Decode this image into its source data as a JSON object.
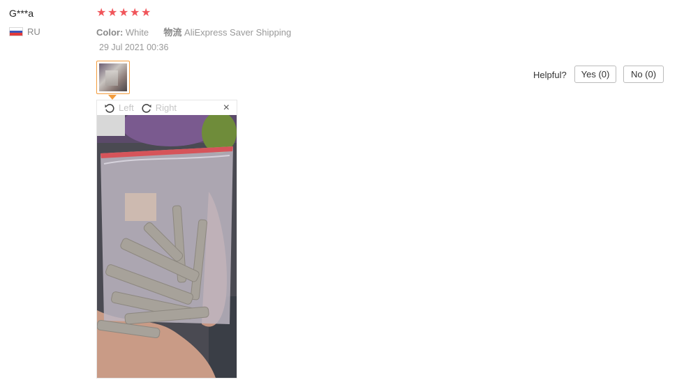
{
  "review": {
    "user_name": "G***a",
    "country": "RU",
    "rating": 5,
    "color_label": "Color:",
    "color_value": "White",
    "shipping_label": "物流",
    "shipping_value": "AliExpress Saver Shipping",
    "date": "29 Jul 2021 00:36"
  },
  "viewer": {
    "left_label": "Left",
    "right_label": "Right",
    "close_glyph": "×"
  },
  "helpful": {
    "label": "Helpful?",
    "yes_label": "Yes (0)",
    "no_label": "No (0)"
  },
  "colors": {
    "star": "#f0555a",
    "thumb_border": "#f39c3c"
  }
}
